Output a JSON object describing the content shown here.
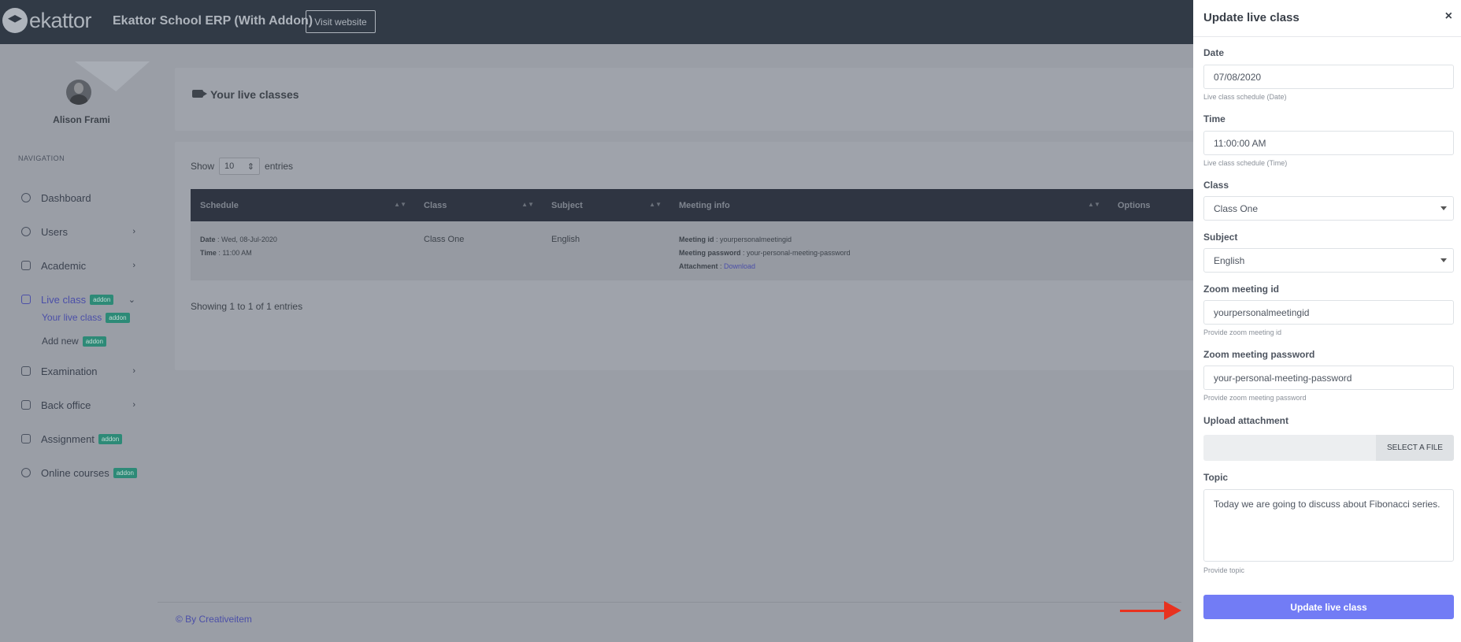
{
  "header": {
    "logo_text": "ekattor",
    "app_title": "Ekattor School ERP (With Addon)",
    "visit_label": "Visit website"
  },
  "sidebar": {
    "profile_name": "Alison Frami",
    "nav_title": "NAVIGATION",
    "badge": "addon",
    "items": {
      "dashboard": "Dashboard",
      "users": "Users",
      "academic": "Academic",
      "live_class": "Live class",
      "your_live_class": "Your live class",
      "add_new": "Add new",
      "examination": "Examination",
      "back_office": "Back office",
      "assignment": "Assignment",
      "online_courses": "Online courses"
    }
  },
  "main": {
    "page_title": "Your live classes",
    "show_label": "Show",
    "entries_value": "10",
    "entries_label": "entries",
    "columns": [
      "Schedule",
      "Class",
      "Subject",
      "Meeting info",
      "Options"
    ],
    "row": {
      "date_label": "Date",
      "date_value": " : Wed, 08-Jul-2020",
      "time_label": "Time",
      "time_value": " : 11:00 AM",
      "class": "Class One",
      "subject": "English",
      "meeting_id_label": "Meeting id",
      "meeting_id_value": " : yourpersonalmeetingid",
      "meeting_pw_label": "Meeting password",
      "meeting_pw_value": " : your-personal-meeting-password",
      "attachment_label": "Attachment",
      "attachment_sep": " : ",
      "attachment_link": "Download"
    },
    "showing_text": "Showing 1 to 1 of 1 entries",
    "footer_text": "© By Creativeitem"
  },
  "panel": {
    "title": "Update live class",
    "close": "×",
    "date_label": "Date",
    "date_value": "07/08/2020",
    "date_help": "Live class schedule (Date)",
    "time_label": "Time",
    "time_value": "11:00:00 AM",
    "time_help": "Live class schedule (Time)",
    "class_label": "Class",
    "class_value": "Class One",
    "subject_label": "Subject",
    "subject_value": "English",
    "zoom_id_label": "Zoom meeting id",
    "zoom_id_value": "yourpersonalmeetingid",
    "zoom_id_help": "Provide zoom meeting id",
    "zoom_pw_label": "Zoom meeting password",
    "zoom_pw_value": "your-personal-meeting-password",
    "zoom_pw_help": "Provide zoom meeting password",
    "upload_label": "Upload attachment",
    "upload_button": "SELECT A FILE",
    "topic_label": "Topic",
    "topic_value": "Today we are going to discuss about Fibonacci series.",
    "topic_help": "Provide topic",
    "submit_label": "Update live class"
  },
  "colors": {
    "header_bg": "#313a46",
    "accent": "#727cf5",
    "badge": "#2d8a77",
    "annotation_arrow": "#e8321f"
  }
}
